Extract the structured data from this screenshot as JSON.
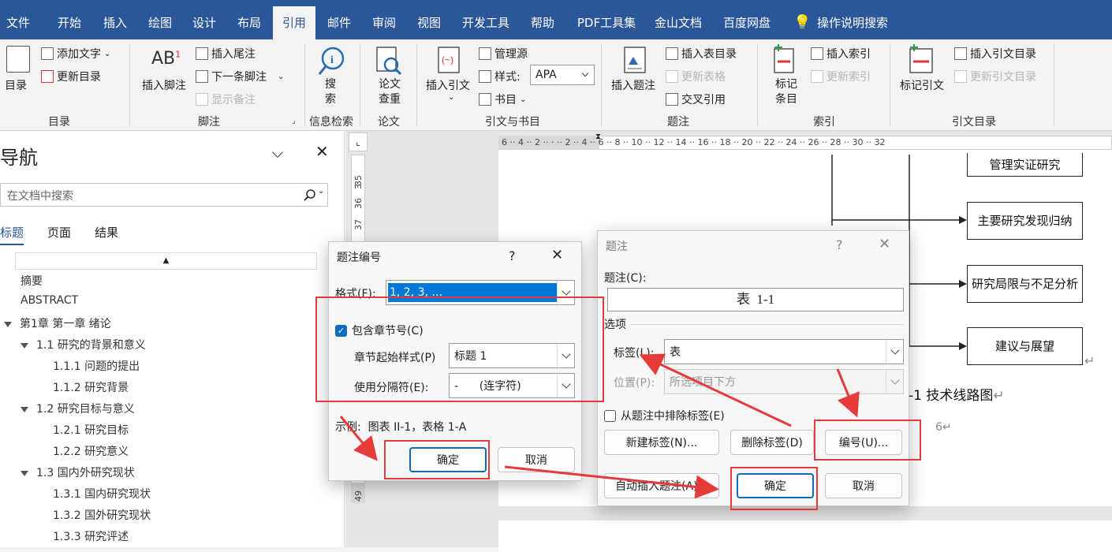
{
  "tabs": [
    "文件",
    "开始",
    "插入",
    "绘图",
    "设计",
    "布局",
    "引用",
    "邮件",
    "审阅",
    "视图",
    "开发工具",
    "帮助",
    "PDF工具集",
    "金山文档",
    "百度网盘",
    "操作说明搜索"
  ],
  "ribbon": {
    "toc": {
      "big": "目录",
      "add_text": "添加文字",
      "update": "更新目录",
      "group": "目录"
    },
    "footnote": {
      "insert": "插入脚注",
      "endnote": "插入尾注",
      "next": "下一条脚注",
      "show": "显示备注",
      "group": "脚注"
    },
    "search": {
      "big": "搜索",
      "group": "信息检索"
    },
    "paper": {
      "big": "论文查重",
      "group": "论文"
    },
    "citation": {
      "insert": "插入引文",
      "manage": "管理源",
      "style_label": "样式:",
      "style_value": "APA",
      "biblio": "书目",
      "group": "引文与书目"
    },
    "caption": {
      "insert": "插入题注",
      "tof": "插入表目录",
      "update_table": "更新表格",
      "cross_ref": "交叉引用",
      "group": "题注"
    },
    "index": {
      "mark": "标记条目",
      "insert": "插入索引",
      "update": "更新索引",
      "group": "索引"
    },
    "toa": {
      "mark": "标记引文",
      "insert": "插入引文目录",
      "update": "更新引文目录",
      "group": "引文目录"
    }
  },
  "nav": {
    "title": "导航",
    "search_placeholder": "在文档中搜索",
    "tabs": [
      "标题",
      "页面",
      "结果"
    ],
    "items": [
      "摘要",
      "ABSTRACT",
      "第1章 第一章 绪论",
      "1.1 研究的背景和意义",
      "1.1.1 问题的提出",
      "1.1.2 研究背景",
      "1.2 研究目标与意义",
      "1.2.1 研究目标",
      "1.2.2 研究意义",
      "1.3 国内外研究现状",
      "1.3.1 国内研究现状",
      "1.3.2 国外研究现状",
      "1.3.3 研究评述"
    ]
  },
  "ruler": {
    "h_ticks": [
      "6",
      "4",
      "2",
      "2",
      "4",
      "6",
      "8",
      "10",
      "12",
      "14",
      "16",
      "18",
      "20",
      "22",
      "24",
      "26",
      "28",
      "30",
      "32"
    ],
    "v_ticks": [
      "3",
      "35",
      "36",
      "37",
      "49"
    ]
  },
  "doc": {
    "boxes": [
      "管理实证研究",
      "主要研究发现归纳",
      "研究局限与不足分析",
      "建议与展望"
    ],
    "figure_caption": "-1 技术线路图",
    "para_mark": "↵",
    "page_number": "6"
  },
  "numbering_dialog": {
    "title": "题注编号",
    "help": "?",
    "format_label": "格式(F):",
    "format_value": "1, 2, 3, …",
    "include_chapter": "包含章节号(C)",
    "chapter_style_label": "章节起始样式(P)",
    "chapter_style_value": "标题 1",
    "separator_label": "使用分隔符(E):",
    "separator_value": "-      (连字符)",
    "example_label": "示例:",
    "example_value": "图表 II-1，表格 1-A",
    "ok": "确定",
    "cancel": "取消"
  },
  "caption_dialog": {
    "title": "题注",
    "help": "?",
    "caption_label": "题注(C):",
    "caption_value": "表  1-1",
    "options_label": "选项",
    "label_label": "标签(L):",
    "label_value": "表",
    "position_label": "位置(P):",
    "position_value": "所选项目下方",
    "exclude_label": "从题注中排除标签(E)",
    "new_label": "新建标签(N)...",
    "delete_label": "删除标签(D)",
    "numbering": "编号(U)...",
    "auto": "自动插入题注(A)...",
    "ok": "确定",
    "cancel": "取消"
  },
  "colors": {
    "accent": "#2b579a",
    "highlight": "#e63b3b",
    "selection": "#0078d7"
  }
}
